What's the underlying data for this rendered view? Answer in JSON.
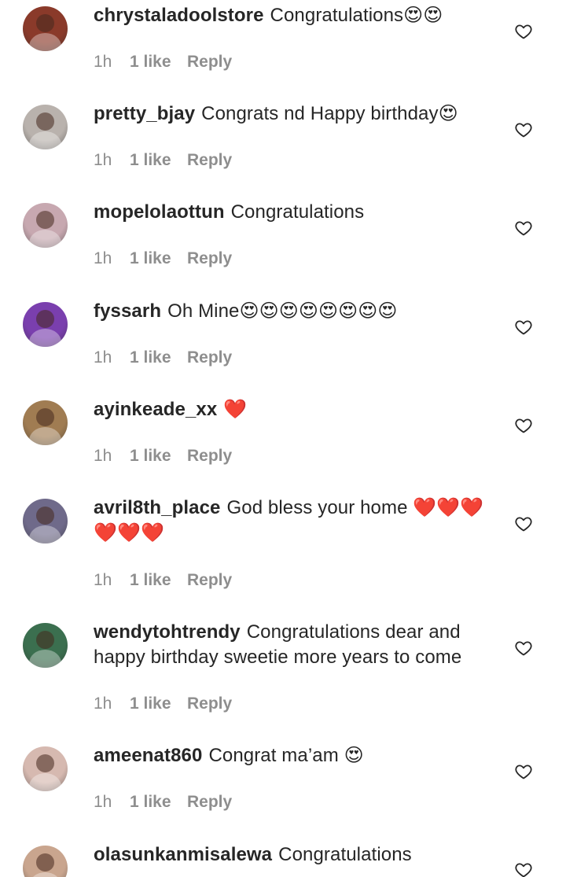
{
  "colors": {
    "text": "#262626",
    "secondary": "#8e8e8e",
    "heart": "#d7192f",
    "background": "#ffffff"
  },
  "comments": [
    {
      "username": "chrystaladoolstore",
      "text": "Congratulations😍😍",
      "time": "1h",
      "likes": "1 like",
      "reply": "Reply",
      "avatar_color": "#8a3a2a",
      "icon": "heart-outline-icon"
    },
    {
      "username": "pretty_bjay",
      "text": "Congrats nd Happy birthday😍",
      "time": "1h",
      "likes": "1 like",
      "reply": "Reply",
      "avatar_color": "#b9b2ad",
      "icon": "heart-outline-icon"
    },
    {
      "username": "mopelolaottun",
      "text": "Congratulations",
      "time": "1h",
      "likes": "1 like",
      "reply": "Reply",
      "avatar_color": "#c7a8b0",
      "icon": "heart-outline-icon"
    },
    {
      "username": "fyssarh",
      "text": "Oh Mine😍😍😍😍😍😍😍😍",
      "time": "1h",
      "likes": "1 like",
      "reply": "Reply",
      "avatar_color": "#7a3fae",
      "icon": "heart-outline-icon"
    },
    {
      "username": "ayinkeade_xx",
      "text": "❤️",
      "time": "1h",
      "likes": "1 like",
      "reply": "Reply",
      "avatar_color": "#a07c52",
      "icon": "heart-outline-icon"
    },
    {
      "username": "avril8th_place",
      "text": "God bless your home ❤️❤️❤️❤️❤️❤️",
      "time": "1h",
      "likes": "1 like",
      "reply": "Reply",
      "avatar_color": "#6f6a8a",
      "icon": "heart-outline-icon"
    },
    {
      "username": "wendytohtrendy",
      "text": "Congratulations dear and happy birthday sweetie more years to come",
      "time": "1h",
      "likes": "1 like",
      "reply": "Reply",
      "avatar_color": "#3b6f4f",
      "icon": "heart-outline-icon"
    },
    {
      "username": "ameenat860",
      "text": "Congrat ma’am 😍",
      "time": "1h",
      "likes": "1 like",
      "reply": "Reply",
      "avatar_color": "#d6b9b0",
      "icon": "heart-outline-icon"
    },
    {
      "username": "olasunkanmisalewa",
      "text": "Congratulations",
      "time": "",
      "likes": "",
      "reply": "",
      "avatar_color": "#c9a58e",
      "icon": "heart-outline-icon"
    }
  ]
}
